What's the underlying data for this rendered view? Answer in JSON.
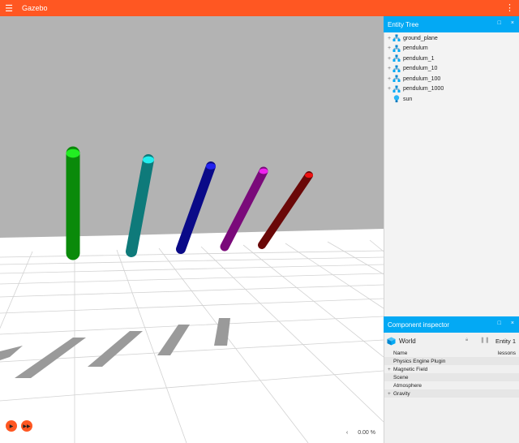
{
  "app": {
    "title": "Gazebo",
    "menu_icon": "hamburger-menu-icon",
    "more_icon": "vertical-dots-icon"
  },
  "scene": {
    "description_colors": {
      "sky": "#b3b3b3",
      "ground": "#ffffff",
      "grid": "#cfcfcf",
      "shadow": "#9e9e9e"
    },
    "pendulums": [
      {
        "name": "pendulum",
        "color": "#0a8a0a",
        "cap": "#22ee22"
      },
      {
        "name": "pendulum_1",
        "color": "#0e7a7a",
        "cap": "#22eeee"
      },
      {
        "name": "pendulum_10",
        "color": "#0a0a88",
        "cap": "#2222ee"
      },
      {
        "name": "pendulum_100",
        "color": "#7a0a7a",
        "cap": "#ee22ee"
      },
      {
        "name": "pendulum_1000",
        "color": "#6a0808",
        "cap": "#ee1111"
      }
    ]
  },
  "controls": {
    "play_icon": "play-icon",
    "step_icon": "fast-forward-icon",
    "rtf_arrow": "‹",
    "rtf_value": "0.00 %"
  },
  "entity_tree": {
    "title": "Entity Tree",
    "items": [
      {
        "label": "ground_plane",
        "expandable": true,
        "icon": "model-icon"
      },
      {
        "label": "pendulum",
        "expandable": true,
        "icon": "model-icon"
      },
      {
        "label": "pendulum_1",
        "expandable": true,
        "icon": "model-icon"
      },
      {
        "label": "pendulum_10",
        "expandable": true,
        "icon": "model-icon"
      },
      {
        "label": "pendulum_100",
        "expandable": true,
        "icon": "model-icon"
      },
      {
        "label": "pendulum_1000",
        "expandable": true,
        "icon": "model-icon"
      },
      {
        "label": "sun",
        "expandable": false,
        "icon": "light-bulb-icon"
      }
    ]
  },
  "inspector": {
    "title": "Component inspector",
    "entity_name": "World",
    "entity_id": "Entity 1",
    "rows": [
      {
        "label": "Name",
        "value": "lessons",
        "expandable": false
      },
      {
        "label": "Physics Engine Plugin",
        "value": "",
        "expandable": false
      },
      {
        "label": "Magnetic Field",
        "value": "",
        "expandable": true
      },
      {
        "label": "Scene",
        "value": "",
        "expandable": false
      },
      {
        "label": "Atmosphere",
        "value": "",
        "expandable": false
      },
      {
        "label": "Gravity",
        "value": "",
        "expandable": true
      }
    ]
  },
  "panel_buttons": {
    "maximize": "□",
    "close": "×"
  }
}
